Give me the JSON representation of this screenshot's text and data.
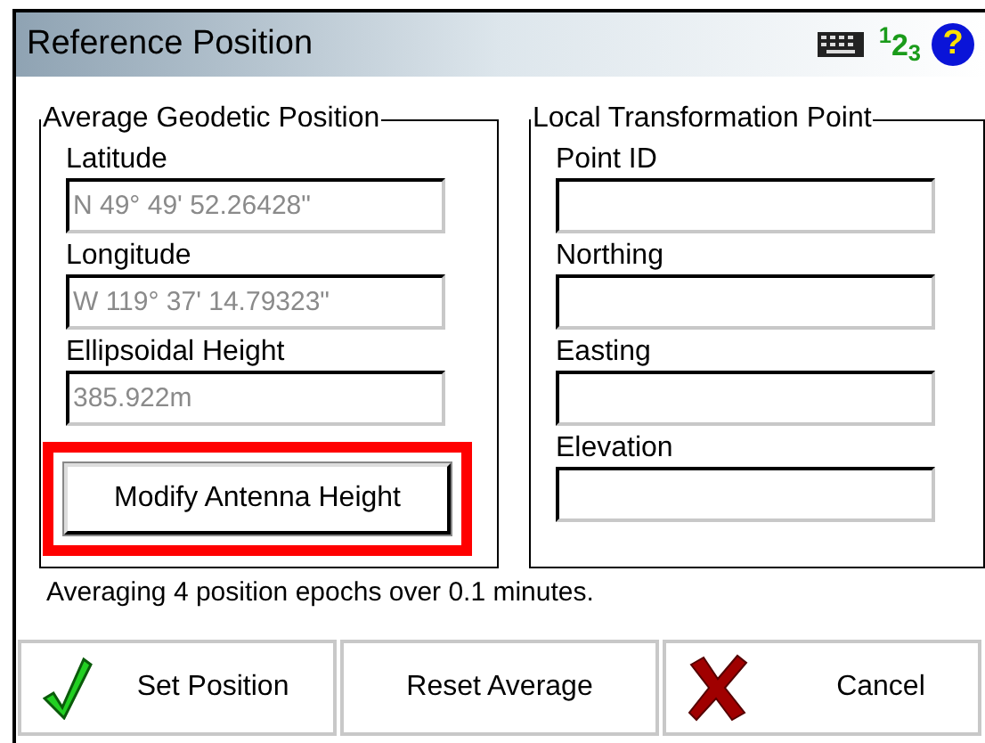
{
  "window": {
    "title": "Reference Position",
    "input_mode": "$^{1}$2$_{3}$",
    "help": "?"
  },
  "groups": [
    {
      "title": "Average Geodetic Position",
      "fields": [
        {
          "label": "Latitude",
          "value": "N 49° 49' 52.26428\"",
          "disabled": true
        },
        {
          "label": "Longitude",
          "value": "W 119° 37' 14.79323\"",
          "disabled": true
        },
        {
          "label": "Ellipsoidal Height",
          "value": "385.922m",
          "disabled": true
        }
      ],
      "button": {
        "label": "Modify Antenna Height",
        "highlighted": true
      }
    },
    {
      "title": "Local Transformation Point",
      "fields": [
        {
          "label": "Point ID"
        },
        {
          "label": "Northing"
        },
        {
          "label": "Easting"
        },
        {
          "label": "Elevation"
        }
      ]
    }
  ],
  "status": "Averaging 4 position epochs over 0.1 minutes.",
  "buttons": [
    {
      "label": "Set Position",
      "kind": "check"
    },
    {
      "label": "Reset Average",
      "kind": "plain"
    },
    {
      "label": "Cancel",
      "kind": "cross"
    }
  ]
}
